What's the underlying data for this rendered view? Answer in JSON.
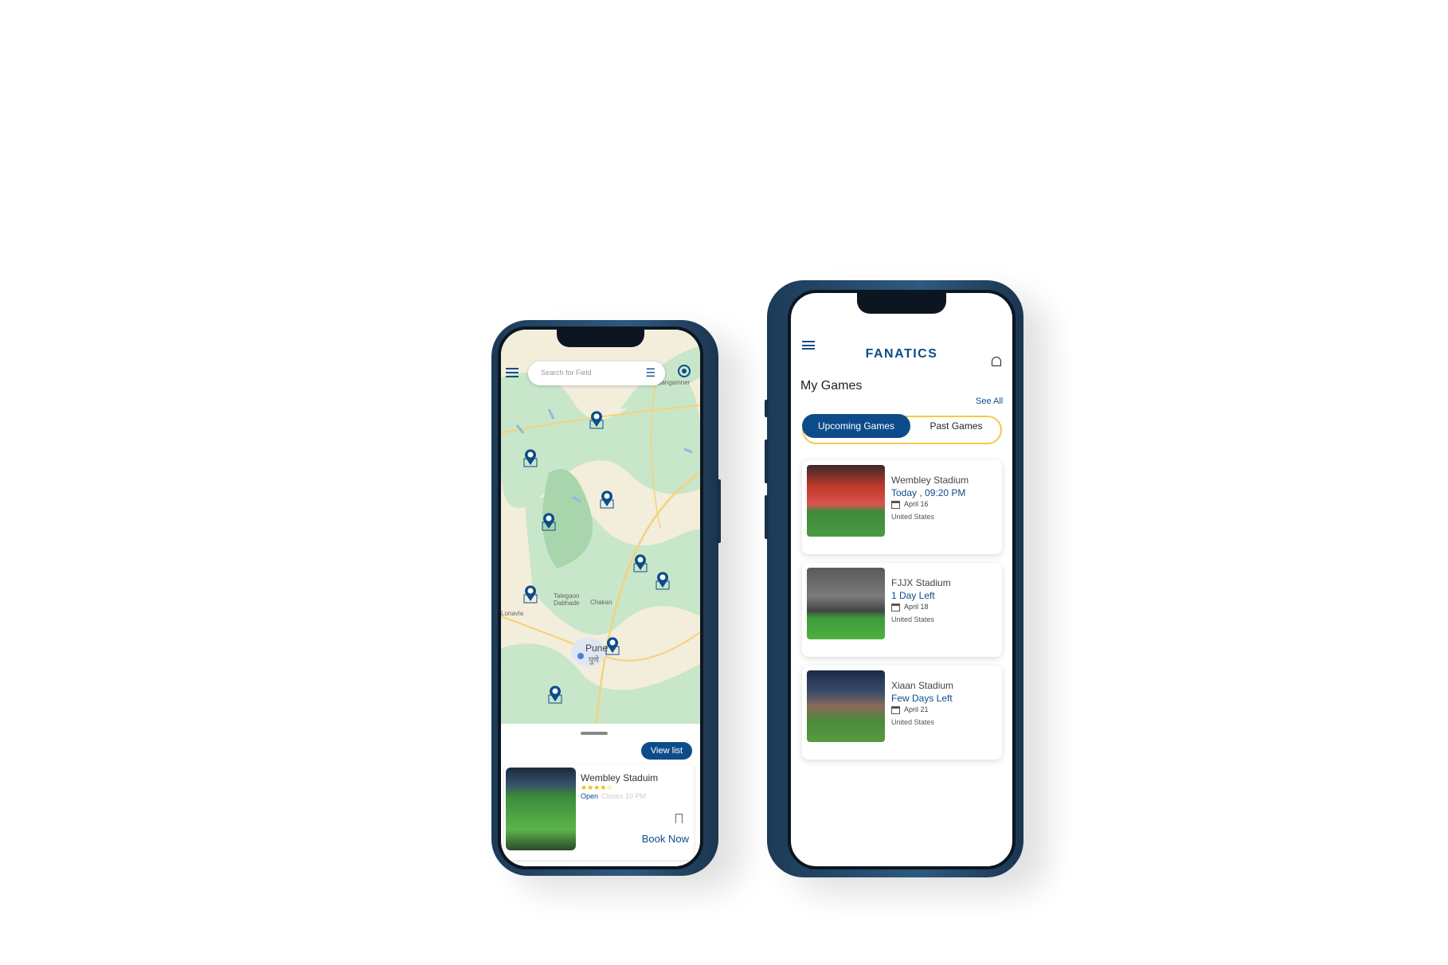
{
  "map_screen": {
    "search_placeholder": "Search for Field",
    "map_labels": {
      "sangamner": "Sangamner",
      "talegaon": "Talegaon Dabhade",
      "chakan": "Chakan",
      "lonavla": "Lonavla",
      "pune": "Pune",
      "pune_local": "पुणे"
    },
    "view_list_label": "View list",
    "field_card": {
      "name": "Wembley  Staduim",
      "rating": 4,
      "rating_max": 5,
      "status": "Open",
      "closes": "Closes 10 PM",
      "book_label": "Book Now"
    }
  },
  "games_screen": {
    "logo": "FANATICS",
    "title": "My Games",
    "see_all": "See All",
    "tabs": [
      {
        "label": "Upcoming Games",
        "active": true
      },
      {
        "label": "Past Games",
        "active": false
      }
    ],
    "games": [
      {
        "stadium": "Wembley Stadium",
        "when": "Today , 09:20 PM",
        "date": "April 16",
        "country": "United States"
      },
      {
        "stadium": "FJJX Stadium",
        "when": "1 Day Left",
        "date": "April 18",
        "country": "United States"
      },
      {
        "stadium": "Xiaan Stadium",
        "when": "Few Days Left",
        "date": "April 21",
        "country": "United States"
      }
    ]
  },
  "colors": {
    "primary": "#0d4c8b",
    "accent": "#f2c94c",
    "map_green": "#c8e6c9",
    "map_base": "#f3eddc"
  }
}
